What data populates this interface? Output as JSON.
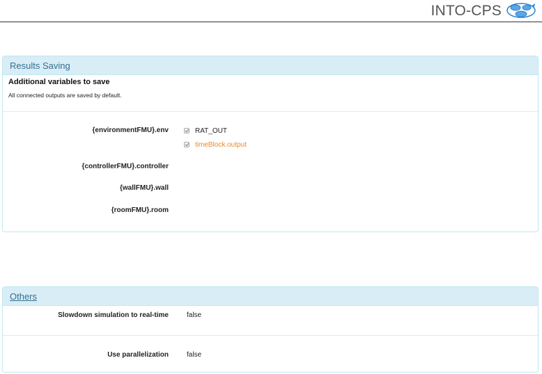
{
  "header": {
    "brand": "INTO-CPS",
    "logo_icon": "into-cps-logo-icon",
    "logo_colors": [
      "#2f7fd1",
      "#5aa7e6"
    ]
  },
  "results_saving": {
    "title": "Results Saving",
    "subtitle": "Additional variables to save",
    "description": "All connected outputs are saved by default.",
    "instances": [
      {
        "label": "{environmentFMU}.env",
        "variables": [
          {
            "name": "RAT_OUT",
            "checked": true,
            "highlight": false
          },
          {
            "name": "timeBlock.output",
            "checked": true,
            "highlight": true
          }
        ]
      },
      {
        "label": "{controllerFMU}.controller",
        "variables": []
      },
      {
        "label": "{wallFMU}.wall",
        "variables": []
      },
      {
        "label": "{roomFMU}.room",
        "variables": []
      }
    ]
  },
  "others": {
    "title": "Others",
    "options": [
      {
        "label": "Slowdown simulation to real-time",
        "value": "false"
      },
      {
        "label": "Use parallelization",
        "value": "false"
      }
    ]
  },
  "colors": {
    "panel_heading_bg": "#d9edf7",
    "panel_border": "#bce8f1",
    "heading_text": "#31708f",
    "highlight_text": "#e8892d"
  }
}
